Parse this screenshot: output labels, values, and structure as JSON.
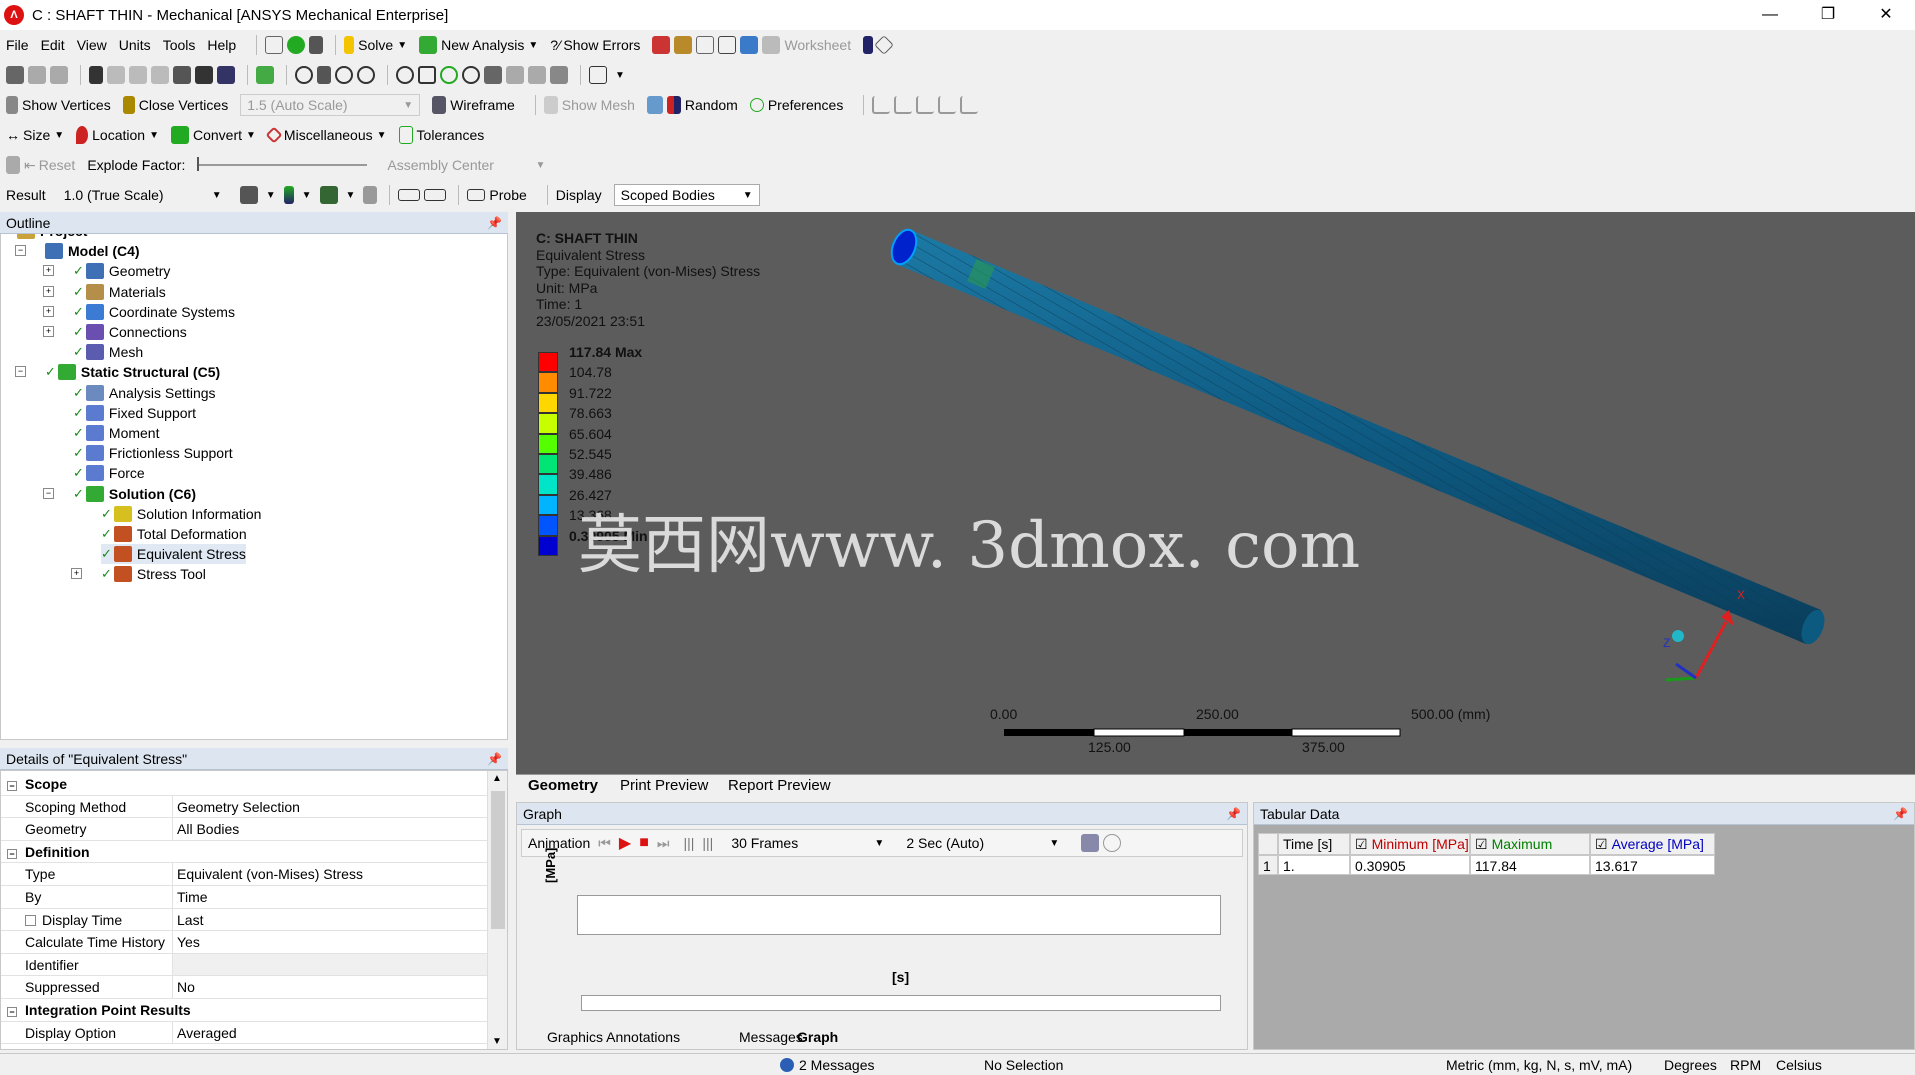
{
  "window": {
    "title": "C : SHAFT THIN - Mechanical [ANSYS Mechanical Enterprise]",
    "controls": [
      "—",
      "❐",
      "✕"
    ]
  },
  "menu": [
    "File",
    "Edit",
    "View",
    "Units",
    "Tools",
    "Help"
  ],
  "toolbar1": {
    "solve": "Solve",
    "new_analysis": "New Analysis",
    "show_errors": "Show Errors",
    "worksheet": "Worksheet"
  },
  "toolbar3": {
    "show_vertices": "Show Vertices",
    "close_vertices": "Close Vertices",
    "scale": "1.5 (Auto Scale)",
    "wireframe": "Wireframe",
    "show_mesh": "Show Mesh",
    "random": "Random",
    "preferences": "Preferences"
  },
  "toolbar4": {
    "size": "Size",
    "location": "Location",
    "convert": "Convert",
    "misc": "Miscellaneous",
    "tolerances": "Tolerances"
  },
  "toolbar5": {
    "reset": "Reset",
    "explode": "Explode Factor:",
    "assembly": "Assembly Center"
  },
  "toolbar6": {
    "result": "Result",
    "result_scale": "1.0 (True Scale)",
    "probe": "Probe",
    "display": "Display",
    "display_value": "Scoped Bodies"
  },
  "outline": {
    "title": "Outline",
    "items": [
      {
        "label": "Project",
        "bold": true
      },
      {
        "label": "Model (C4)",
        "bold": true
      },
      {
        "label": "Geometry"
      },
      {
        "label": "Materials"
      },
      {
        "label": "Coordinate Systems"
      },
      {
        "label": "Connections"
      },
      {
        "label": "Mesh"
      },
      {
        "label": "Static Structural (C5)",
        "bold": true
      },
      {
        "label": "Analysis Settings"
      },
      {
        "label": "Fixed Support"
      },
      {
        "label": "Moment"
      },
      {
        "label": "Frictionless Support"
      },
      {
        "label": "Force"
      },
      {
        "label": "Solution (C6)",
        "bold": true
      },
      {
        "label": "Solution Information"
      },
      {
        "label": "Total Deformation"
      },
      {
        "label": "Equivalent Stress"
      },
      {
        "label": "Stress Tool"
      }
    ]
  },
  "details": {
    "title": "Details of \"Equivalent Stress\"",
    "rows": [
      {
        "k": "Scope",
        "group": true
      },
      {
        "k": "Scoping Method",
        "v": "Geometry Selection"
      },
      {
        "k": "Geometry",
        "v": "All Bodies"
      },
      {
        "k": "Definition",
        "group": true
      },
      {
        "k": "Type",
        "v": "Equivalent (von-Mises) Stress"
      },
      {
        "k": "By",
        "v": "Time"
      },
      {
        "k": "Display Time",
        "v": "Last"
      },
      {
        "k": "Calculate Time History",
        "v": "Yes"
      },
      {
        "k": "Identifier",
        "v": ""
      },
      {
        "k": "Suppressed",
        "v": "No"
      },
      {
        "k": "Integration Point Results",
        "group": true
      },
      {
        "k": "Display Option",
        "v": "Averaged"
      }
    ]
  },
  "viewport": {
    "header": [
      "C: SHAFT THIN",
      "Equivalent Stress",
      "Type: Equivalent (von-Mises) Stress",
      "Unit: MPa",
      "Time: 1",
      "23/05/2021 23:51"
    ],
    "legend": [
      {
        "label": "117.84 Max",
        "color": "#ff0000"
      },
      {
        "label": "104.78",
        "color": "#ff8c00"
      },
      {
        "label": "91.722",
        "color": "#ffd700"
      },
      {
        "label": "78.663",
        "color": "#c8ff00"
      },
      {
        "label": "65.604",
        "color": "#55ff00"
      },
      {
        "label": "52.545",
        "color": "#00e676"
      },
      {
        "label": "39.486",
        "color": "#00e5c8"
      },
      {
        "label": "26.427",
        "color": "#00b4ff"
      },
      {
        "label": "13.368",
        "color": "#0055ff"
      },
      {
        "label": "0.30905 Min",
        "color": "#0000d0"
      }
    ],
    "scale": {
      "top": [
        "0.00",
        "250.00",
        "500.00 (mm)"
      ],
      "bottom": [
        "125.00",
        "375.00"
      ]
    },
    "watermark": "莫西网www. 3dmox. com",
    "axis": {
      "x": "X",
      "z": "Z"
    }
  },
  "view_tabs": [
    "Geometry",
    "Print Preview",
    "Report Preview"
  ],
  "graph": {
    "title": "Graph",
    "animation": "Animation",
    "frames": "30 Frames",
    "duration": "2 Sec (Auto)",
    "yunit": "[MPa]",
    "xunit": "[s]",
    "tabs": [
      "Graphics Annotations",
      "Messages",
      "Graph"
    ]
  },
  "tabular": {
    "title": "Tabular Data",
    "headers": [
      "Time [s]",
      "Minimum [MPa]",
      "Maximum [MPa]",
      "Average [MPa]"
    ],
    "header_colors": [
      "#000000",
      "#c00000",
      "#008000",
      "#0000c0"
    ],
    "rows": [
      [
        "1",
        "1.",
        "0.30905",
        "117.84",
        "13.617"
      ]
    ]
  },
  "status": {
    "messages": "2 Messages",
    "selection": "No Selection",
    "units": "Metric (mm, kg, N, s, mV, mA)",
    "angle": "Degrees",
    "rpm": "RPM",
    "temp": "Celsius"
  }
}
